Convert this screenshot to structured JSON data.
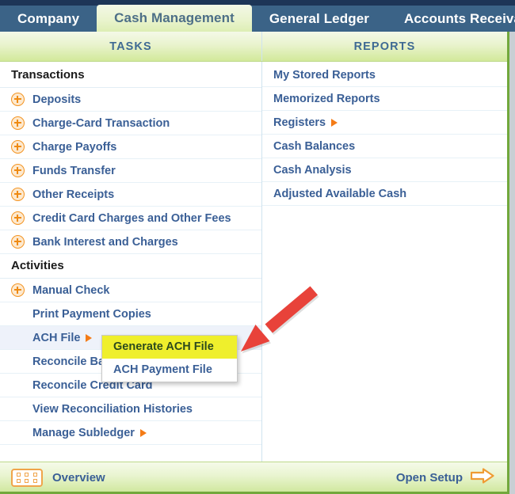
{
  "navbar": {
    "tabs": [
      {
        "label": "Company",
        "active": false
      },
      {
        "label": "Cash Management",
        "active": true
      },
      {
        "label": "General Ledger",
        "active": false
      },
      {
        "label": "Accounts Receiva",
        "active": false
      }
    ]
  },
  "headers": {
    "tasks": "TASKS",
    "reports": "REPORTS"
  },
  "tasks": {
    "sections": [
      {
        "title": "Transactions",
        "items": [
          {
            "label": "Deposits",
            "icon": "plus-circle-icon",
            "submenu_arrow": false,
            "highlighted": false
          },
          {
            "label": "Charge-Card Transaction",
            "icon": "plus-circle-icon",
            "submenu_arrow": false,
            "highlighted": false
          },
          {
            "label": "Charge Payoffs",
            "icon": "plus-circle-icon",
            "submenu_arrow": false,
            "highlighted": false
          },
          {
            "label": "Funds Transfer",
            "icon": "plus-circle-icon",
            "submenu_arrow": false,
            "highlighted": false
          },
          {
            "label": "Other Receipts",
            "icon": "plus-circle-icon",
            "submenu_arrow": false,
            "highlighted": false
          },
          {
            "label": "Credit Card Charges and Other Fees",
            "icon": "plus-circle-icon",
            "submenu_arrow": false,
            "highlighted": false
          },
          {
            "label": "Bank Interest and Charges",
            "icon": "plus-circle-icon",
            "submenu_arrow": false,
            "highlighted": false
          }
        ]
      },
      {
        "title": "Activities",
        "items": [
          {
            "label": "Manual Check",
            "icon": "plus-circle-icon",
            "submenu_arrow": false,
            "highlighted": false
          },
          {
            "label": "Print Payment Copies",
            "icon": "none",
            "submenu_arrow": false,
            "highlighted": false
          },
          {
            "label": "ACH File",
            "icon": "none",
            "submenu_arrow": true,
            "highlighted": true
          },
          {
            "label": "Reconcile Bank Account",
            "icon": "none",
            "submenu_arrow": false,
            "highlighted": false
          },
          {
            "label": "Reconcile Credit Card",
            "icon": "none",
            "submenu_arrow": false,
            "highlighted": false
          },
          {
            "label": "View Reconciliation Histories",
            "icon": "none",
            "submenu_arrow": false,
            "highlighted": false
          },
          {
            "label": "Manage Subledger",
            "icon": "none",
            "submenu_arrow": true,
            "highlighted": false
          }
        ]
      }
    ]
  },
  "reports": {
    "items": [
      {
        "label": "My Stored Reports",
        "submenu_arrow": false
      },
      {
        "label": "Memorized Reports",
        "submenu_arrow": false
      },
      {
        "label": "Registers",
        "submenu_arrow": true
      },
      {
        "label": "Cash Balances",
        "submenu_arrow": false
      },
      {
        "label": "Cash Analysis",
        "submenu_arrow": false
      },
      {
        "label": "Adjusted Available Cash",
        "submenu_arrow": false
      }
    ]
  },
  "submenu": {
    "parent": "ACH File",
    "items": [
      {
        "label": "Generate ACH File",
        "selected": true
      },
      {
        "label": "ACH Payment File",
        "selected": false
      }
    ]
  },
  "annotation": {
    "type": "red-arrow",
    "color": "#e8423a",
    "points_to": "Generate ACH File"
  },
  "footer": {
    "overview_label": "Overview",
    "overview_icon": "grid-overview-icon",
    "open_setup_label": "Open Setup",
    "open_setup_icon": "arrow-right-icon"
  },
  "colors": {
    "navbar_bg": "#3b6387",
    "navbar_top": "#1d3557",
    "active_tab_bg": "#eaf4cf",
    "active_tab_text": "#4d6f87",
    "header_band": "#d2e99a",
    "link_text": "#3a5f96",
    "accent_orange": "#f47b16",
    "highlight_yellow": "#efef2c",
    "panel_border_green": "#72a83c",
    "row_highlight": "#eef2fa",
    "arrow_red": "#e8423a"
  }
}
